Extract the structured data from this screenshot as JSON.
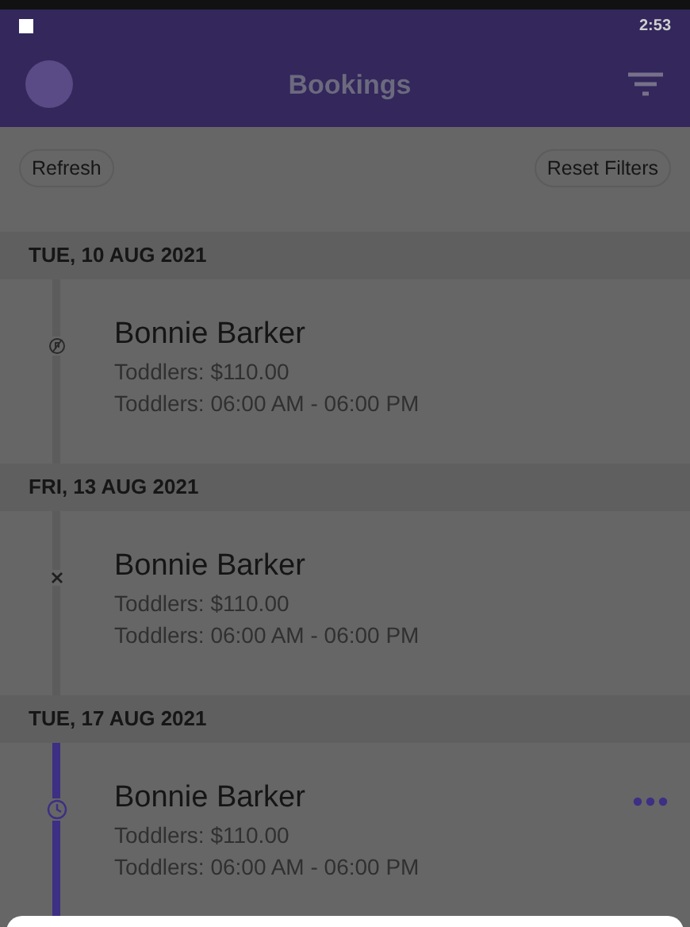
{
  "status_bar": {
    "time": "2:53"
  },
  "header": {
    "title": "Bookings"
  },
  "actions": [
    "Refresh",
    "Reset Filters"
  ],
  "groups": [
    {
      "date": "TUE, 10 AUG 2021",
      "bookings": [
        {
          "name": "Bonnie Barker",
          "price": "Toddlers: $110.00",
          "time": "Toddlers: 06:00 AM - 06:00 PM",
          "kind": "declined",
          "has_menu": false
        }
      ]
    },
    {
      "date": "FRI, 13 AUG 2021",
      "bookings": [
        {
          "name": "Bonnie Barker",
          "price": "Toddlers: $110.00",
          "time": "Toddlers: 06:00 AM - 06:00 PM",
          "kind": "cancelled",
          "has_menu": false
        }
      ]
    },
    {
      "date": "TUE, 17 AUG 2021",
      "bookings": [
        {
          "name": "Bonnie Barker",
          "price": "Toddlers: $110.00",
          "time": "Toddlers: 06:00 AM - 06:00 PM",
          "kind": "pending",
          "has_menu": true
        }
      ]
    }
  ]
}
